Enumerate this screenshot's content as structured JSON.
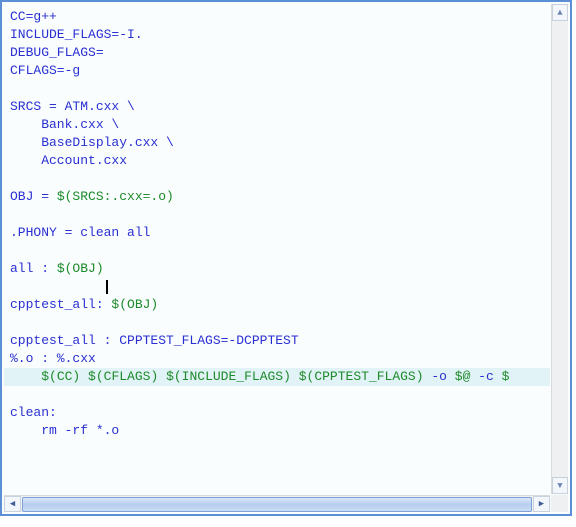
{
  "code": {
    "lines": [
      {
        "text": "CC=g++"
      },
      {
        "text": "INCLUDE_FLAGS=-I."
      },
      {
        "text": "DEBUG_FLAGS="
      },
      {
        "text": "CFLAGS=-g"
      },
      {
        "text": ""
      },
      {
        "text": "SRCS = ATM.cxx \\"
      },
      {
        "text": "    Bank.cxx \\"
      },
      {
        "text": "    BaseDisplay.cxx \\"
      },
      {
        "text": "    Account.cxx"
      },
      {
        "text": ""
      },
      {
        "segments": [
          {
            "text": "OBJ = ",
            "cls": "tok-default"
          },
          {
            "text": "$(SRCS:.cxx=.o)",
            "cls": "tok-var"
          }
        ]
      },
      {
        "text": ""
      },
      {
        "text": ".PHONY = clean all"
      },
      {
        "text": ""
      },
      {
        "segments": [
          {
            "text": "all : ",
            "cls": "tok-default"
          },
          {
            "text": "$(OBJ)",
            "cls": "tok-var"
          }
        ]
      },
      {
        "text": ""
      },
      {
        "segments": [
          {
            "text": "cpptest_all: ",
            "cls": "tok-default"
          },
          {
            "text": "$(OBJ)",
            "cls": "tok-var"
          }
        ]
      },
      {
        "text": ""
      },
      {
        "text": "cpptest_all : CPPTEST_FLAGS=-DCPPTEST"
      },
      {
        "text": "%.o : %.cxx"
      },
      {
        "highlight": true,
        "segments": [
          {
            "text": "    ",
            "cls": "tok-default"
          },
          {
            "text": "$(CC)",
            "cls": "tok-var"
          },
          {
            "text": " ",
            "cls": "tok-default"
          },
          {
            "text": "$(CFLAGS)",
            "cls": "tok-var"
          },
          {
            "text": " ",
            "cls": "tok-default"
          },
          {
            "text": "$(INCLUDE_FLAGS)",
            "cls": "tok-var"
          },
          {
            "text": " ",
            "cls": "tok-default"
          },
          {
            "text": "$(CPPTEST_FLAGS)",
            "cls": "tok-var"
          },
          {
            "text": " -o ",
            "cls": "tok-default"
          },
          {
            "text": "$@",
            "cls": "tok-var"
          },
          {
            "text": " -c ",
            "cls": "tok-default"
          },
          {
            "text": "$",
            "cls": "tok-var"
          }
        ]
      },
      {
        "text": ""
      },
      {
        "text": "clean:"
      },
      {
        "text": "    rm -rf *.o"
      }
    ],
    "caret": {
      "line": 15,
      "col": 12
    }
  },
  "scroll": {
    "up": "▲",
    "down": "▼",
    "left": "◀",
    "right": "▶"
  }
}
